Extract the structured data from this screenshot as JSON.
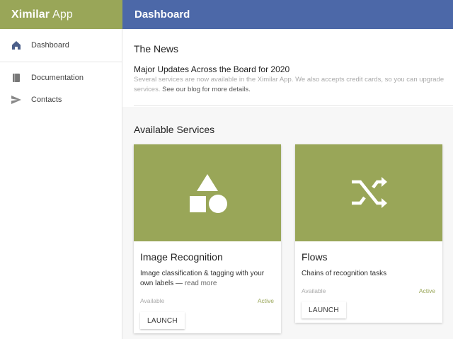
{
  "colors": {
    "brand": "#99a658",
    "header": "#4c68a8",
    "status": "#99a658"
  },
  "app": {
    "name_bold": "Ximilar",
    "name_thin": "App"
  },
  "header": {
    "title": "Dashboard"
  },
  "sidebar": {
    "items": [
      {
        "label": "Dashboard",
        "icon": "home-icon"
      },
      {
        "label": "Documentation",
        "icon": "book-icon"
      },
      {
        "label": "Contacts",
        "icon": "send-icon"
      }
    ]
  },
  "news": {
    "heading": "The News",
    "title": "Major Updates Across the Board for 2020",
    "body": "Several services are now available in the Ximilar App. We also accepts credit cards, so you can upgrade services.",
    "link": "See our blog for more details."
  },
  "services": {
    "heading": "Available Services",
    "cards": [
      {
        "name": "Image Recognition",
        "icon": "shapes-icon",
        "description": "Image classification & tagging with your own labels —",
        "more": "read more",
        "availability": "Available",
        "status": "Active",
        "button": "LAUNCH"
      },
      {
        "name": "Flows",
        "icon": "shuffle-icon",
        "description": "Chains of recognition tasks",
        "more": "",
        "availability": "Available",
        "status": "Active",
        "button": "LAUNCH"
      }
    ]
  }
}
